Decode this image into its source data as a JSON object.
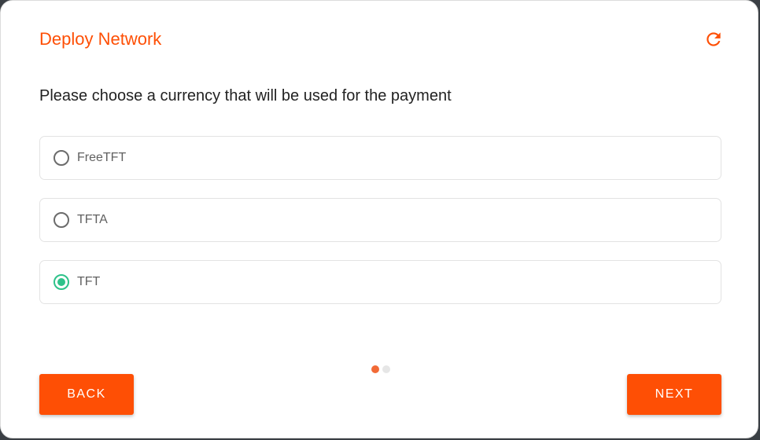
{
  "dialog": {
    "title": "Deploy Network",
    "refresh_icon": "refresh-icon",
    "prompt": "Please choose a currency that will be used for the payment",
    "options": [
      {
        "label": "FreeTFT",
        "selected": false
      },
      {
        "label": "TFTA",
        "selected": false
      },
      {
        "label": "TFT",
        "selected": true
      }
    ],
    "steps": {
      "current": 1,
      "total": 2
    },
    "back_label": "BACK",
    "next_label": "NEXT"
  },
  "colors": {
    "accent": "#fe4f05",
    "selected": "#2ec28a",
    "step_active": "#f26a36",
    "step_inactive": "#e6e6e6"
  }
}
